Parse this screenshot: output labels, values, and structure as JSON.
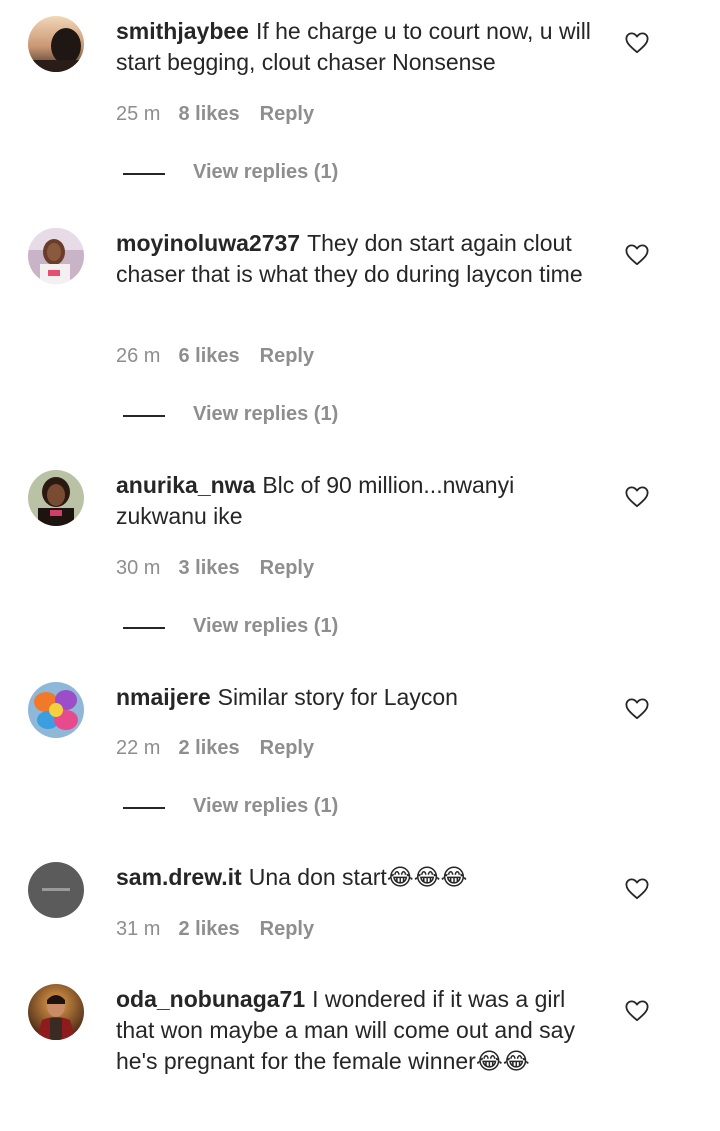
{
  "comments": [
    {
      "username": "smithjaybee",
      "text": "If he charge u to court now, u will start begging, clout chaser Nonsense",
      "time": "25 m",
      "likes": "8 likes",
      "reply": "Reply",
      "view_replies": "View replies (1)",
      "avatar_icon": "avatar-photo"
    },
    {
      "username": "moyinoluwa2737",
      "text": "They don start again clout chaser that is what they do during laycon time",
      "time": "26 m",
      "likes": "6 likes",
      "reply": "Reply",
      "view_replies": "View replies (1)",
      "avatar_icon": "avatar-photo"
    },
    {
      "username": "anurika_nwa",
      "text": "Blc of 90 million...nwanyi zukwanu ike",
      "time": "30 m",
      "likes": "3 likes",
      "reply": "Reply",
      "view_replies": "View replies (1)",
      "avatar_icon": "avatar-photo"
    },
    {
      "username": "nmaijere",
      "text": "Similar story for Laycon",
      "time": "22 m",
      "likes": "2 likes",
      "reply": "Reply",
      "view_replies": "View replies (1)",
      "avatar_icon": "avatar-photo"
    },
    {
      "username": "sam.drew.it",
      "text": "Una don start😂😂😂",
      "time": "31 m",
      "likes": "2 likes",
      "reply": "Reply",
      "avatar_icon": "avatar-photo"
    },
    {
      "username": "oda_nobunaga71",
      "text": "I wondered if it was a girl that won maybe a man will come out and say he's pregnant for the female winner😂😂",
      "avatar_icon": "avatar-photo"
    }
  ],
  "icons": {
    "like": "heart-outline-icon"
  },
  "colors": {
    "text_primary": "#262626",
    "text_secondary": "#8e8e8e",
    "background": "#ffffff"
  }
}
